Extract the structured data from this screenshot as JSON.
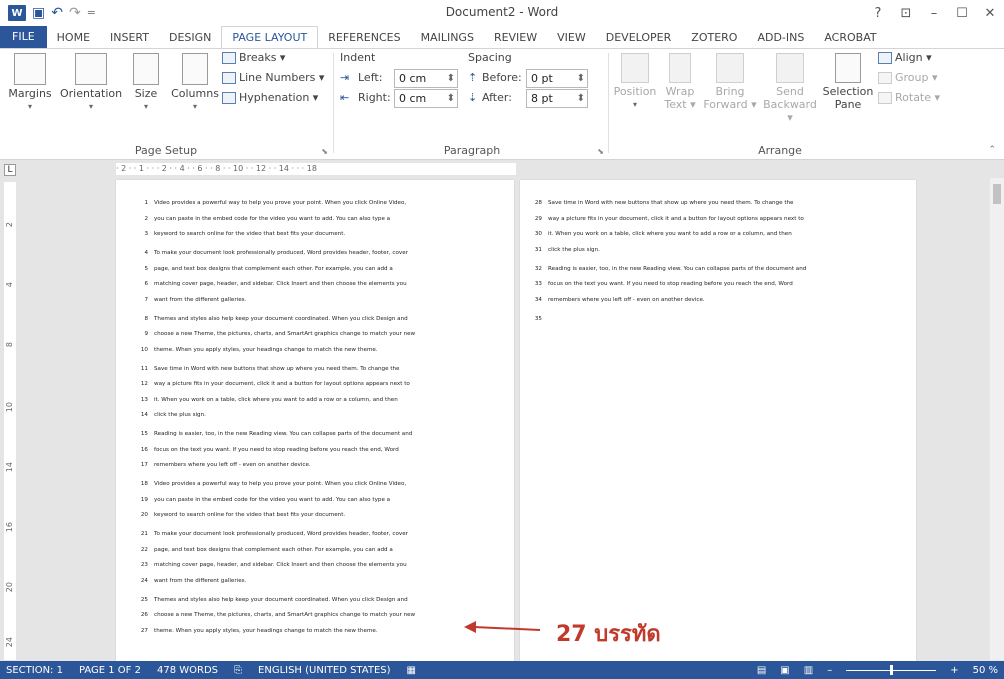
{
  "window": {
    "title": "Document2 - Word",
    "controls": [
      "?",
      "⊡",
      "–",
      "☐",
      "✕"
    ]
  },
  "qat": {
    "undo": "↶",
    "redo": "↷",
    "dropdown": "="
  },
  "tabs": [
    "FILE",
    "HOME",
    "INSERT",
    "DESIGN",
    "PAGE LAYOUT",
    "REFERENCES",
    "MAILINGS",
    "REVIEW",
    "VIEW",
    "DEVELOPER",
    "ZOTERO",
    "ADD-INS",
    "ACROBAT"
  ],
  "ribbon": {
    "page_setup": {
      "label": "Page Setup",
      "margins": "Margins",
      "orientation": "Orientation",
      "size": "Size",
      "columns": "Columns",
      "breaks": "Breaks ▾",
      "line_numbers": "Line Numbers ▾",
      "hyphenation": "Hyphenation ▾"
    },
    "paragraph": {
      "label": "Paragraph",
      "indent": "Indent",
      "left": "Left:",
      "left_value": "0 cm",
      "right": "Right:",
      "right_value": "0 cm",
      "spacing": "Spacing",
      "before": "Before:",
      "before_value": "0 pt",
      "after": "After:",
      "after_value": "8 pt"
    },
    "arrange": {
      "label": "Arrange",
      "position": "Position",
      "wrap_text": "Wrap Text ▾",
      "bring_forward": "Bring Forward ▾",
      "send_backward": "Send Backward ▾",
      "selection_pane": "Selection Pane",
      "align": "Align ▾",
      "group": "Group ▾",
      "rotate": "Rotate ▾"
    }
  },
  "ruler": {
    "corner": "L",
    "h_text": "· 2 ·  · 1 ·  ·  · 2 ·  · 4 ·  · 6 ·  · 8 ·  · 10 ·  · 12 ·  · 14 ·  ·  · 18"
  },
  "page1_lines": [
    {
      "n": "1",
      "t": "Video provides a powerful way to help you prove your point. When you click Online Video,"
    },
    {
      "n": "2",
      "t": "you can paste in the embed code for the video you want to add. You can also type a"
    },
    {
      "n": "3",
      "t": "keyword to search online for the video that best fits your document."
    },
    {
      "n": "4",
      "t": "To make your document look professionally produced, Word provides header, footer, cover"
    },
    {
      "n": "5",
      "t": "page, and text box designs that complement each other. For example, you can add a"
    },
    {
      "n": "6",
      "t": "matching cover page, header, and sidebar. Click Insert and then choose the elements you"
    },
    {
      "n": "7",
      "t": "want from the different galleries."
    },
    {
      "n": "8",
      "t": "Themes and styles also help keep your document coordinated. When you click Design and"
    },
    {
      "n": "9",
      "t": "choose a new Theme, the pictures, charts, and SmartArt graphics change to match your new"
    },
    {
      "n": "10",
      "t": "theme. When you apply styles, your headings change to match the new theme."
    },
    {
      "n": "11",
      "t": "Save time in Word with new buttons that show up where you need them. To change the"
    },
    {
      "n": "12",
      "t": "way a picture fits in your document, click it and a button for layout options appears next to"
    },
    {
      "n": "13",
      "t": "it. When you work on a table, click where you want to add a row or a column, and then"
    },
    {
      "n": "14",
      "t": "click the plus sign."
    },
    {
      "n": "15",
      "t": "Reading is easier, too, in the new Reading view. You can collapse parts of the document and"
    },
    {
      "n": "16",
      "t": "focus on the text you want. If you need to stop reading before you reach the end, Word"
    },
    {
      "n": "17",
      "t": "remembers where you left off - even on another device."
    },
    {
      "n": "18",
      "t": "Video provides a powerful way to help you prove your point. When you click Online Video,"
    },
    {
      "n": "19",
      "t": "you can paste in the embed code for the video you want to add. You can also type a"
    },
    {
      "n": "20",
      "t": "keyword to search online for the video that best fits your document."
    },
    {
      "n": "21",
      "t": "To make your document look professionally produced, Word provides header, footer, cover"
    },
    {
      "n": "22",
      "t": "page, and text box designs that complement each other. For example, you can add a"
    },
    {
      "n": "23",
      "t": "matching cover page, header, and sidebar. Click Insert and then choose the elements you"
    },
    {
      "n": "24",
      "t": "want from the different galleries."
    },
    {
      "n": "25",
      "t": "Themes and styles also help keep your document coordinated. When you click Design and"
    },
    {
      "n": "26",
      "t": "choose a new Theme, the pictures, charts, and SmartArt graphics change to match your new"
    },
    {
      "n": "27",
      "t": "theme. When you apply styles, your headings change to match the new theme."
    }
  ],
  "page2_lines": [
    {
      "n": "28",
      "t": "Save time in Word with new buttons that show up where you need them. To change the"
    },
    {
      "n": "29",
      "t": "way a picture fits in your document, click it and a button for layout options appears next to"
    },
    {
      "n": "30",
      "t": "it. When you work on a table, click where you want to add a row or a column, and then"
    },
    {
      "n": "31",
      "t": "click the plus sign."
    },
    {
      "n": "32",
      "t": "Reading is easier, too, in the new Reading view. You can collapse parts of the document and"
    },
    {
      "n": "33",
      "t": "focus on the text you want. If you need to stop reading before you reach the end, Word"
    },
    {
      "n": "34",
      "t": "remembers where you left off - even on another device."
    },
    {
      "n": "35",
      "t": ""
    }
  ],
  "annotation": "27 บรรทัด",
  "status": {
    "section": "SECTION: 1",
    "page": "PAGE 1 OF 2",
    "words": "478 WORDS",
    "language": "ENGLISH (UNITED STATES)",
    "zoom": "50 %"
  },
  "colors": {
    "brand": "#2b579a",
    "annotation": "#c0392b"
  }
}
